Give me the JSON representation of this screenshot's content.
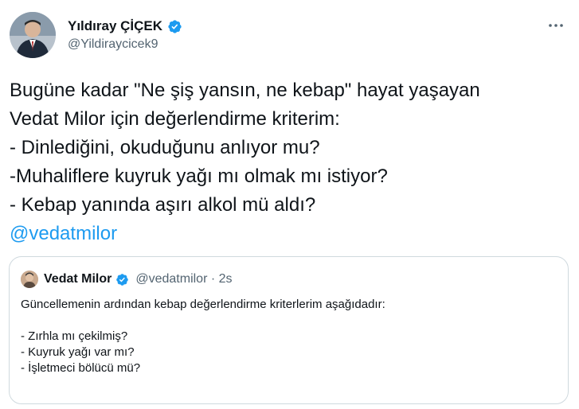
{
  "tweet": {
    "author": {
      "display_name": "Yıldıray ÇİÇEK",
      "handle": "@Yildiraycicek9",
      "verified": true
    },
    "more_icon": "more-horizontal-icon",
    "text_lines": [
      "Bugüne kadar \"Ne şiş yansın, ne kebap\" hayat yaşayan",
      "Vedat Milor için değerlendirme kriterim:",
      "- Dinlediğini, okuduğunu anlıyor mu?",
      "-Muhaliflere kuyruk yağı mı olmak mı istiyor?",
      "- Kebap yanında aşırı alkol mü aldı?"
    ],
    "mention": "@vedatmilor"
  },
  "quote": {
    "author": {
      "display_name": "Vedat Milor",
      "meta": "@vedatmilor · 2s",
      "verified": true
    },
    "text_lines": [
      "Güncellemenin ardından kebap değerlendirme kriterlerim aşağıdadır:",
      "",
      "- Zırhla mı çekilmiş?",
      "- Kuyruk yağı var mı?",
      "- İşletmeci bölücü mü?"
    ]
  },
  "colors": {
    "text": "#0f1419",
    "secondary": "#536471",
    "link": "#1d9bf0",
    "verified": "#1d9bf0",
    "border": "#cfd9de"
  }
}
